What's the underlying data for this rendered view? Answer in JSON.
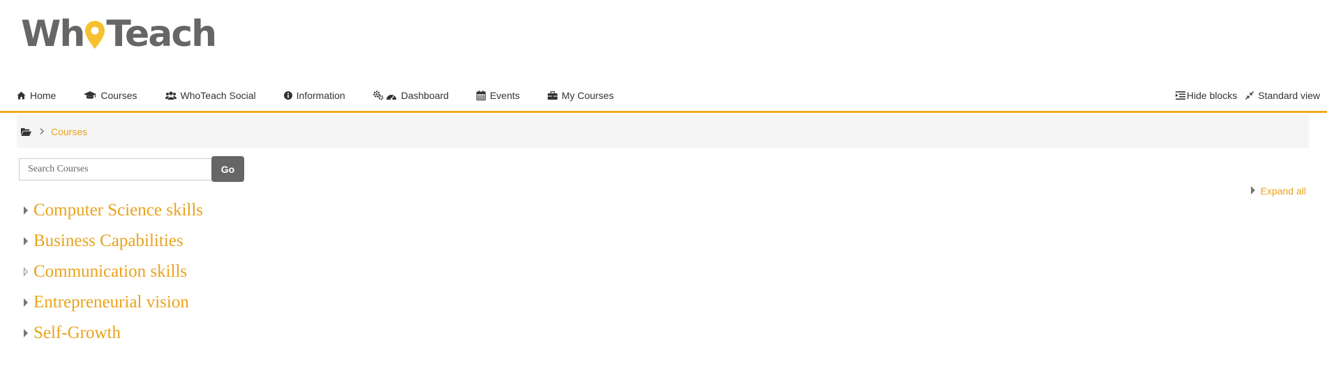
{
  "brand": {
    "logo_text_left": "Wh",
    "logo_text_right": "Teach",
    "logo_color": "#666666",
    "pin_color": "#f5c12e"
  },
  "nav": {
    "items": [
      {
        "label": "Home",
        "icon": "home-icon"
      },
      {
        "label": "Courses",
        "icon": "graduation-cap-icon"
      },
      {
        "label": "WhoTeach Social",
        "icon": "users-icon"
      },
      {
        "label": "Information",
        "icon": "info-circle-icon"
      },
      {
        "label": "Dashboard",
        "icon": "cogs-dashboard-icon"
      },
      {
        "label": "Events",
        "icon": "calendar-icon"
      },
      {
        "label": "My Courses",
        "icon": "briefcase-icon"
      }
    ],
    "right": [
      {
        "label": "Hide blocks",
        "icon": "indent-icon"
      },
      {
        "label": "Standard view",
        "icon": "compress-icon"
      }
    ],
    "accent_color": "#f0a91d"
  },
  "breadcrumb": {
    "items": [
      "Courses"
    ]
  },
  "search": {
    "placeholder": "Search Courses",
    "button_label": "Go"
  },
  "expand_all_label": "Expand all",
  "categories": [
    "Computer Science skills",
    "Business Capabilities",
    "Communication skills",
    "Entrepreneurial vision",
    "Self-Growth"
  ],
  "link_color": "#e9a31c"
}
